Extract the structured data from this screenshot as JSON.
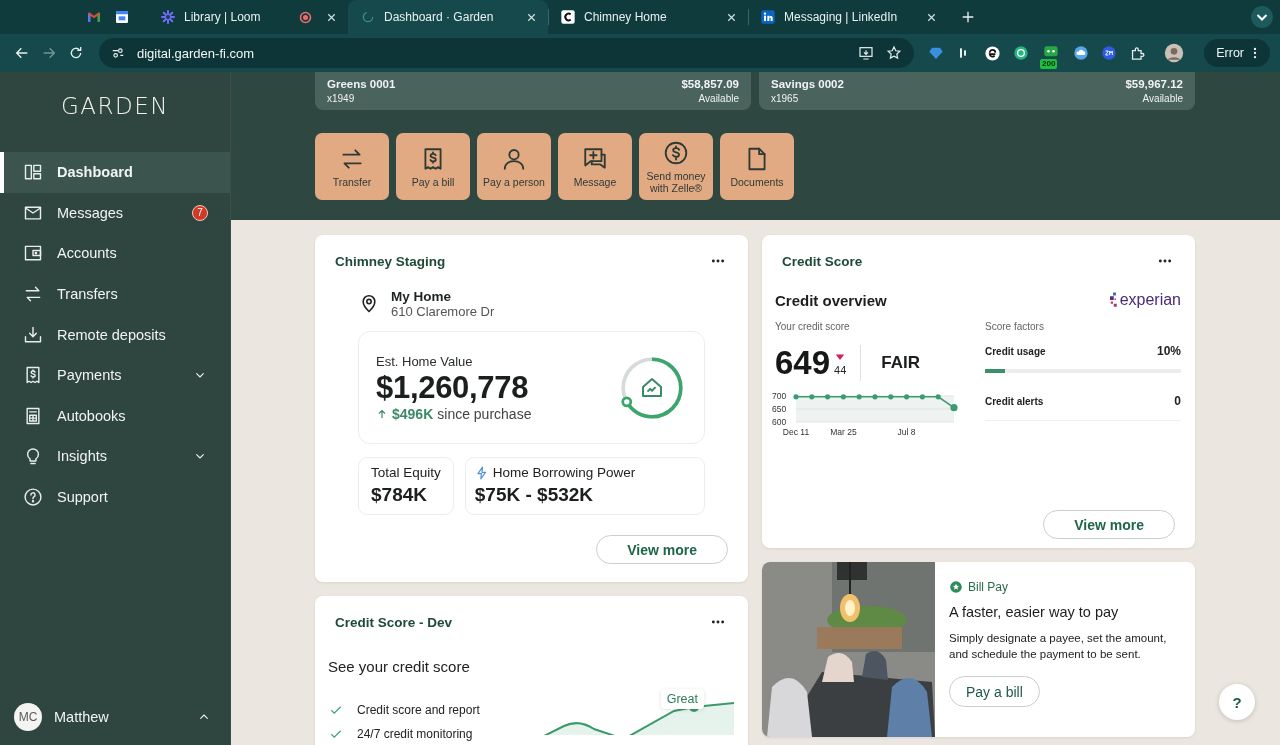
{
  "browser": {
    "tabs": [
      {
        "title": "Library | Loom",
        "selected": false,
        "recording": true
      },
      {
        "title": "Dashboard · Garden",
        "selected": true,
        "recording": false
      },
      {
        "title": "Chimney Home",
        "selected": false,
        "recording": false
      },
      {
        "title": "Messaging | LinkedIn",
        "selected": false,
        "recording": false
      }
    ],
    "url": "digital.garden-fi.com",
    "extension_badge": "200",
    "profile_button": "Error"
  },
  "sidebar": {
    "logo": "GARDEN",
    "items": [
      {
        "label": "Dashboard",
        "selected": true,
        "kind": "link"
      },
      {
        "label": "Messages",
        "selected": false,
        "kind": "link",
        "badge": "7"
      },
      {
        "label": "Accounts",
        "selected": false,
        "kind": "link"
      },
      {
        "label": "Transfers",
        "selected": false,
        "kind": "link"
      },
      {
        "label": "Remote deposits",
        "selected": false,
        "kind": "link"
      },
      {
        "label": "Payments",
        "selected": false,
        "kind": "group"
      },
      {
        "label": "Autobooks",
        "selected": false,
        "kind": "link"
      },
      {
        "label": "Insights",
        "selected": false,
        "kind": "group"
      },
      {
        "label": "Support",
        "selected": false,
        "kind": "link"
      }
    ],
    "user": {
      "initials": "MC",
      "name": "Matthew"
    }
  },
  "accounts": [
    {
      "name": "Greens 0001",
      "number": "x1949",
      "balance": "$58,857.09",
      "balance_label": "Available"
    },
    {
      "name": "Savings 0002",
      "number": "x1965",
      "balance": "$59,967.12",
      "balance_label": "Available"
    }
  ],
  "quick_actions": [
    "Transfer",
    "Pay a bill",
    "Pay a person",
    "Message",
    "Send money with Zelle®",
    "Documents"
  ],
  "home_card": {
    "title": "Chimney Staging",
    "place": "My Home",
    "address": "610 Claremore Dr",
    "value_label": "Est. Home Value",
    "value": "$1,260,778",
    "change": "$496K",
    "change_suffix": "since purchase",
    "equity_label": "Total Equity",
    "equity": "$784K",
    "borrowing_label": "Home Borrowing Power",
    "borrowing": "$75K - $532K",
    "button": "View more"
  },
  "credit_card": {
    "title": "Credit Score",
    "heading": "Credit overview",
    "brand": "experian",
    "score_label": "Your credit score",
    "score": "649",
    "change": "44",
    "rating": "FAIR",
    "chart_data": {
      "type": "line",
      "categories": [
        "Dec 11",
        null,
        null,
        "Mar 25",
        null,
        null,
        null,
        "Jul 8",
        null,
        null,
        null
      ],
      "series": [
        {
          "color": "#3d9a72",
          "values": [
            697,
            697,
            697,
            697,
            697,
            697,
            697,
            697,
            697,
            697,
            655
          ]
        }
      ],
      "ylim": [
        600,
        700
      ],
      "yticks": [
        600,
        650,
        700
      ]
    },
    "factors_label": "Score factors",
    "factors": [
      {
        "kind": "bar",
        "label": "Credit usage",
        "value": "10%",
        "level": 0.1
      },
      {
        "kind": "count",
        "label": "Credit alerts",
        "value": "0"
      }
    ],
    "button": "View more"
  },
  "dev_card": {
    "title": "Credit Score - Dev",
    "heading": "See your credit score",
    "features": [
      "Credit score and report",
      "24/7 credit monitoring"
    ],
    "chart_label": "Great"
  },
  "bill_card": {
    "tag": "Bill Pay",
    "heading": "A faster, easier way to pay",
    "text": "Simply designate a payee, set the amount, and schedule the payment to be sent.",
    "button": "Pay a bill"
  },
  "help_button": "?"
}
